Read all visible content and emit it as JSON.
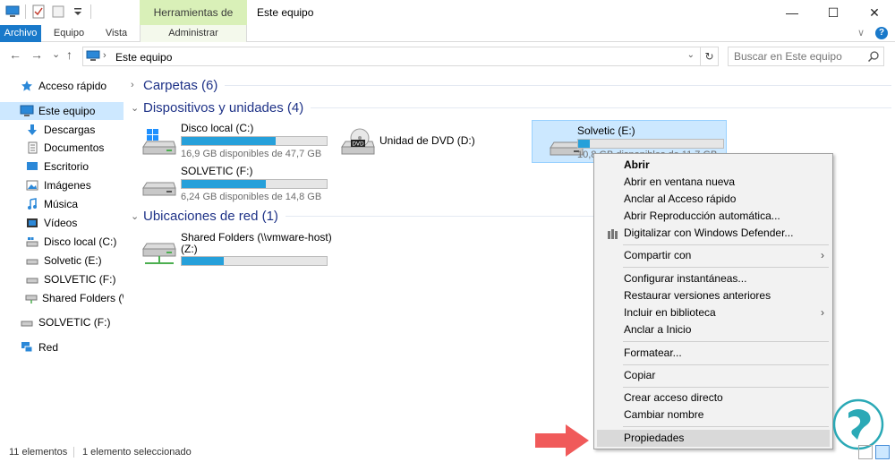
{
  "window": {
    "title": "Este equipo",
    "contextual_tab_group": "Herramientas de unidad",
    "minimize_glyph": "—",
    "maximize_glyph": "☐",
    "close_glyph": "✕"
  },
  "ribbon": {
    "tabs": [
      {
        "label": "Archivo",
        "active": true
      },
      {
        "label": "Equipo"
      },
      {
        "label": "Vista"
      },
      {
        "label": "Administrar"
      }
    ],
    "expand_glyph": "∨",
    "help_glyph": "?"
  },
  "nav": {
    "back_glyph": "←",
    "forward_glyph": "→",
    "recent_glyph": "⌄",
    "up_glyph": "↑"
  },
  "address": {
    "path": "Este equipo",
    "separator": "›",
    "dropdown_glyph": "⌄",
    "refresh_glyph": "↻"
  },
  "search": {
    "placeholder": "Buscar en Este equipo"
  },
  "sidebar": {
    "items": [
      {
        "label": "Acceso rápido",
        "icon": "star-icon"
      },
      {
        "label": "Este equipo",
        "icon": "computer-icon",
        "selected": true
      },
      {
        "label": "Descargas",
        "icon": "download-icon"
      },
      {
        "label": "Documentos",
        "icon": "documents-icon"
      },
      {
        "label": "Escritorio",
        "icon": "desktop-icon"
      },
      {
        "label": "Imágenes",
        "icon": "pictures-icon"
      },
      {
        "label": "Música",
        "icon": "music-icon"
      },
      {
        "label": "Vídeos",
        "icon": "videos-icon"
      },
      {
        "label": "Disco local (C:)",
        "icon": "drive-icon"
      },
      {
        "label": "Solvetic (E:)",
        "icon": "drive-icon"
      },
      {
        "label": "SOLVETIC (F:)",
        "icon": "drive-icon"
      },
      {
        "label": "Shared Folders (\\\\vm",
        "icon": "network-drive-icon"
      },
      {
        "label": "SOLVETIC (F:)",
        "icon": "drive-icon"
      },
      {
        "label": "Red",
        "icon": "network-icon"
      }
    ]
  },
  "content": {
    "sections": {
      "folders": "Carpetas (6)",
      "devices": "Dispositivos y unidades (4)",
      "network": "Ubicaciones de red (1)"
    },
    "drives": [
      {
        "name": "Disco local (C:)",
        "size": "16,9 GB disponibles de 47,7 GB",
        "used_fraction": 0.65,
        "icon": "windows-drive-icon"
      },
      {
        "name": "Unidad de DVD (D:)",
        "icon": "dvd-drive-icon"
      },
      {
        "name": "Solvetic (E:)",
        "size": "10,8 GB disponibles de 11,7 GB",
        "used_fraction": 0.08,
        "icon": "drive-icon",
        "selected": true
      },
      {
        "name": "SOLVETIC (F:)",
        "size": "6,24 GB disponibles de 14,8 GB",
        "used_fraction": 0.58,
        "icon": "drive-icon"
      }
    ],
    "network_drives": [
      {
        "name_line1": "Shared Folders (\\\\vmware-host)",
        "name_line2": "(Z:)",
        "used_fraction": 0.29,
        "icon": "network-drive-icon"
      }
    ]
  },
  "context_menu": {
    "items": [
      {
        "label": "Abrir",
        "bold": true
      },
      {
        "label": "Abrir en ventana nueva"
      },
      {
        "label": "Anclar al Acceso rápido"
      },
      {
        "label": "Abrir Reproducción automática..."
      },
      {
        "label": "Digitalizar con Windows Defender...",
        "icon": "defender-icon"
      },
      {
        "label": "Compartir con",
        "submenu": true
      },
      {
        "label": "Configurar instantáneas..."
      },
      {
        "label": "Restaurar versiones anteriores"
      },
      {
        "label": "Incluir en biblioteca",
        "submenu": true
      },
      {
        "label": "Anclar a Inicio"
      },
      {
        "label": "Formatear..."
      },
      {
        "label": "Copiar"
      },
      {
        "label": "Crear acceso directo"
      },
      {
        "label": "Cambiar nombre"
      },
      {
        "label": "Propiedades",
        "highlighted": true
      }
    ],
    "submenu_glyph": "›"
  },
  "statusbar": {
    "item_count": "11 elementos",
    "selection": "1 elemento seleccionado"
  },
  "colors": {
    "accent": "#1979ca",
    "selection": "#cde8ff",
    "capacity_bar": "#26a0da",
    "section_header": "#1e3287",
    "contextual_tab": "#d9f0b8",
    "arrow": "#f05a5a"
  }
}
